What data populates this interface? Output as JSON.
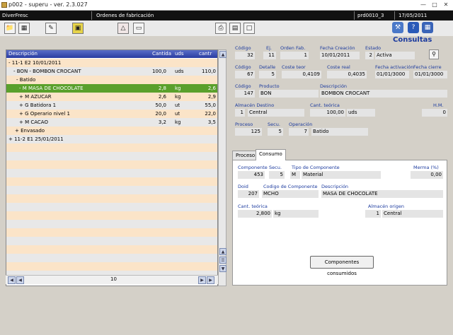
{
  "window": {
    "title": "p002 - superu - ver. 2.3.027"
  },
  "status": {
    "company": "DiverFresc",
    "module": "Ordenes de fabricación",
    "session": "prd0010_3",
    "date": "17/05/2011"
  },
  "header": {
    "title": "Consultas"
  },
  "tree": {
    "columns": {
      "desc": "Descripción",
      "qty": "Cantida",
      "unit": "uds",
      "qty2": "cantr"
    },
    "rows": [
      {
        "text": "- 11-1 E2 10/01/2011",
        "qty": "",
        "unit": "",
        "qty2": ""
      },
      {
        "text": "- BON - BOMBON CROCANT",
        "qty": "100,0",
        "unit": "uds",
        "qty2": "110,0"
      },
      {
        "text": "- Batido",
        "qty": "",
        "unit": "",
        "qty2": ""
      },
      {
        "text": "- M MASA DE CHOCOLATE",
        "qty": "2,8",
        "unit": "kg",
        "qty2": "2,6"
      },
      {
        "text": "+ M AZUCAR",
        "qty": "2,6",
        "unit": "kg",
        "qty2": "2,9"
      },
      {
        "text": "+ G Batidora 1",
        "qty": "50,0",
        "unit": "ut",
        "qty2": "55,0"
      },
      {
        "text": "+ G Operario nivel 1",
        "qty": "20,0",
        "unit": "ut",
        "qty2": "22,0"
      },
      {
        "text": "+ M CACAO",
        "qty": "3,2",
        "unit": "kg",
        "qty2": "3,5"
      },
      {
        "text": "+ Envasado",
        "qty": "",
        "unit": "",
        "qty2": ""
      },
      {
        "text": "+ 11-2 E1 25/01/2011",
        "qty": "",
        "unit": "",
        "qty2": ""
      }
    ],
    "page": "10"
  },
  "order": {
    "l_codigo": "Código",
    "codigo": "32",
    "l_ej": "Ej.",
    "ej": "11",
    "l_orden": "Orden Fab.",
    "orden": "1",
    "l_fcrea": "Fecha Creación",
    "fcrea": "10/01/2011",
    "l_estado": "Estado",
    "estado_num": "2",
    "estado": "Activa"
  },
  "detail": {
    "l_codigo": "Código",
    "codigo": "67",
    "l_detalle": "Detalle",
    "detalle": "5",
    "l_cteor": "Coste teor",
    "cteor": "0,4109",
    "l_creal": "Coste real",
    "creal": "0,4035",
    "l_fact": "Fecha activación",
    "fact": "01/01/3000",
    "l_fcierre": "Fecha cierre",
    "fcierre": "01/01/3000"
  },
  "product": {
    "l_codigo": "Código",
    "codigo": "147",
    "l_producto": "Producto",
    "producto": "BON",
    "l_desc": "Descripción",
    "desc": "BOMBON CROCANT"
  },
  "store": {
    "l_alm": "Almacén Destino",
    "alm_num": "1",
    "alm": "Central",
    "l_cant": "Cant. teórica",
    "cant": "100,00",
    "cant_unit": "uds",
    "l_hm": "H.M.",
    "hm": "0"
  },
  "process": {
    "l_proc": "Proceso",
    "proc": "125",
    "l_secu": "Secu.",
    "secu": "5",
    "l_oper": "Operación",
    "oper_num": "7",
    "oper": "Batido"
  },
  "tabs": {
    "proceso": "Proceso",
    "consumo": "Consumo"
  },
  "consumo": {
    "l_comp": "Componente",
    "comp": "453",
    "l_secu": "Secu.",
    "secu": "5",
    "l_tipo": "Tipo de Componente",
    "tipo_code": "M",
    "tipo": "Material",
    "l_merma": "Merma (%)",
    "merma": "0,00",
    "l_doid": "Doid",
    "doid": "207",
    "l_codcomp": "Codigo de Componente",
    "codcomp": "MCHO",
    "l_desc": "Descripción",
    "desc": "MASA DE CHOCOLATE",
    "l_cant": "Cant. teórica",
    "cant": "2,800",
    "cant_unit": "kg",
    "l_alm": "Almacén origen",
    "alm_num": "1",
    "alm": "Central",
    "button": "Componentes consumidos"
  },
  "colors": {
    "selected_row": "#5aa02c",
    "band_a": "#fbe4c8",
    "band_b": "#e8e8e8",
    "label": "#1b3a9e"
  }
}
